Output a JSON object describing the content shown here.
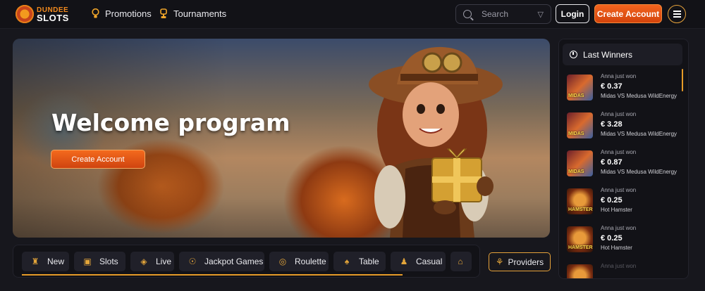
{
  "header": {
    "logo": {
      "line1": "DUNDEE",
      "line2": "SLOTS"
    },
    "nav": [
      {
        "label": "Promotions",
        "icon": "lightbulb-icon"
      },
      {
        "label": "Tournaments",
        "icon": "trophy-icon"
      }
    ],
    "search": {
      "placeholder": "Search"
    },
    "login_label": "Login",
    "create_account_label": "Create Account"
  },
  "banner": {
    "title": "Welcome program",
    "cta_label": "Create Account"
  },
  "categories": [
    {
      "label": "New",
      "icon": "new-icon"
    },
    {
      "label": "Slots",
      "icon": "slots-icon"
    },
    {
      "label": "Live",
      "icon": "live-icon"
    },
    {
      "label": "Jackpot Games",
      "icon": "jackpot-icon"
    },
    {
      "label": "Roulette",
      "icon": "roulette-icon"
    },
    {
      "label": "Table",
      "icon": "table-icon"
    },
    {
      "label": "Casual",
      "icon": "casual-icon"
    },
    {
      "label": "",
      "icon": "more-icon"
    }
  ],
  "providers_label": "Providers",
  "winners": {
    "title": "Last Winners",
    "items": [
      {
        "who": "Anna just won",
        "amount": "€ 0.37",
        "game": "Midas VS Medusa WildEnergy",
        "thumb_label": "MIDAS"
      },
      {
        "who": "Anna just won",
        "amount": "€ 3.28",
        "game": "Midas VS Medusa WildEnergy",
        "thumb_label": "MIDAS"
      },
      {
        "who": "Anna just won",
        "amount": "€ 0.87",
        "game": "Midas VS Medusa WildEnergy",
        "thumb_label": "MIDAS"
      },
      {
        "who": "Anna just won",
        "amount": "€ 0.25",
        "game": "Hot Hamster",
        "thumb_label": "HAMSTER"
      },
      {
        "who": "Anna just won",
        "amount": "€ 0.25",
        "game": "Hot Hamster",
        "thumb_label": "HAMSTER"
      },
      {
        "who": "Anna just won",
        "amount": "",
        "game": "",
        "thumb_label": ""
      }
    ]
  },
  "colors": {
    "accent": "#f2641e",
    "gold": "#e6a23a",
    "background": "#17171d"
  }
}
